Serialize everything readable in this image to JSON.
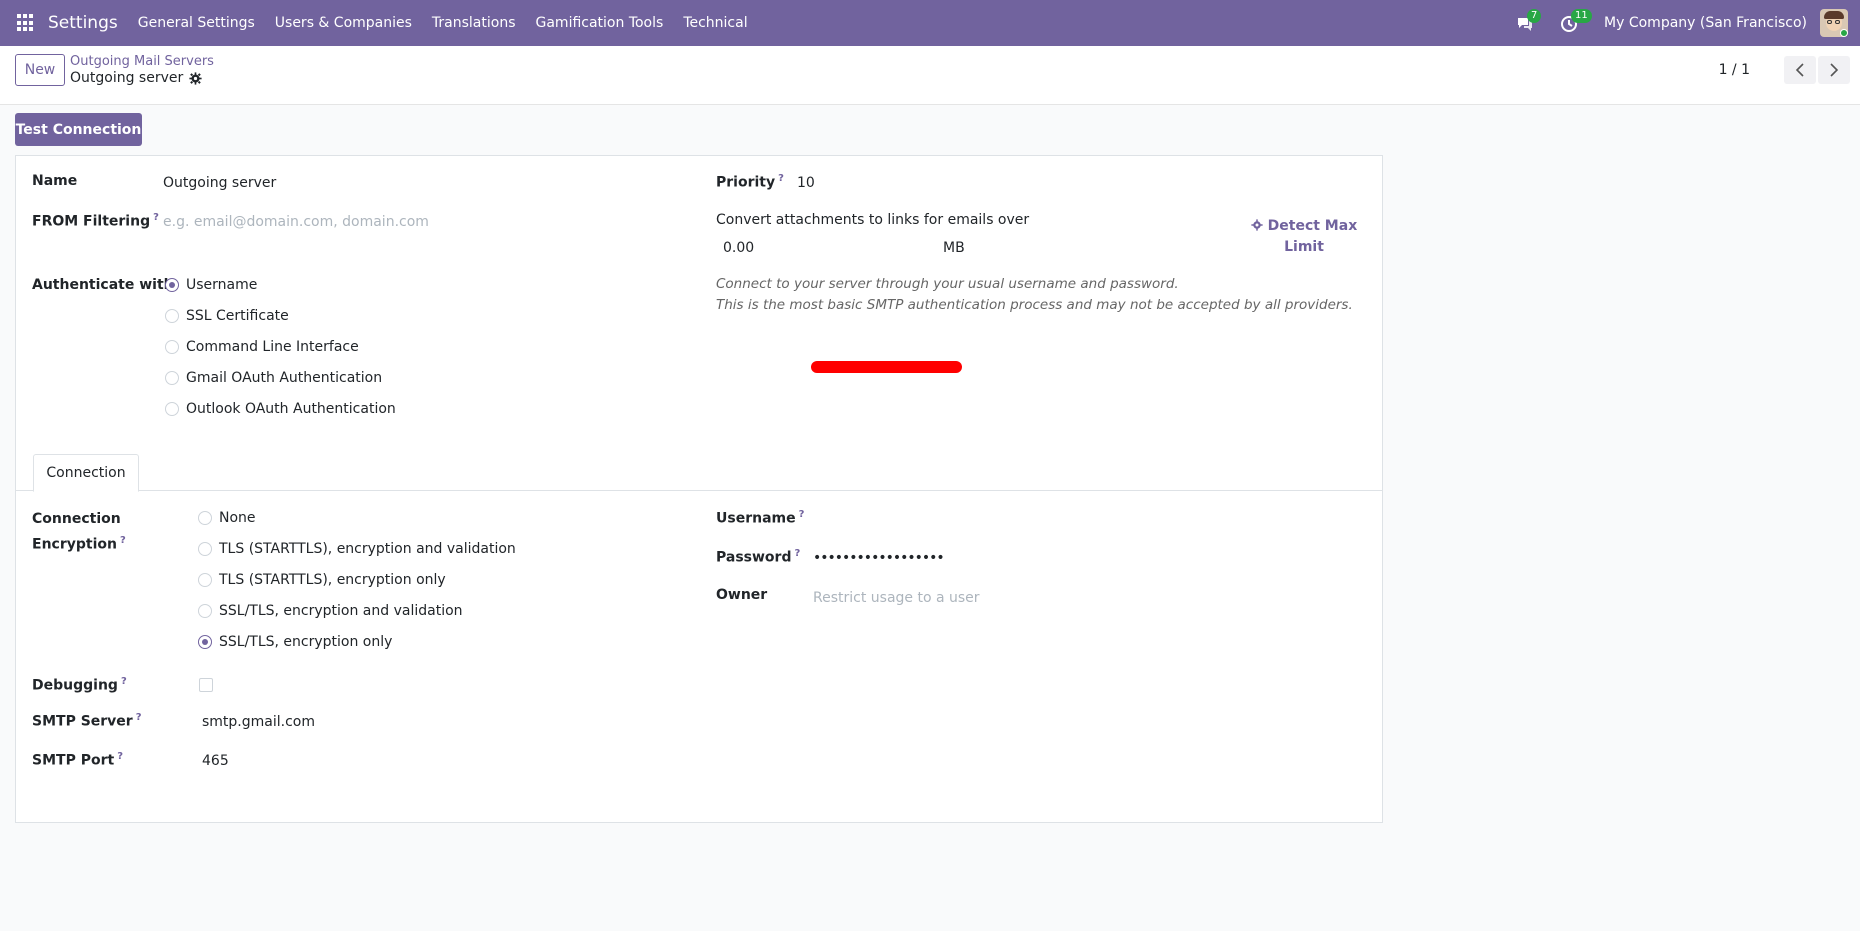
{
  "navbar": {
    "brand": "Settings",
    "menu": [
      "General Settings",
      "Users & Companies",
      "Translations",
      "Gamification Tools",
      "Technical"
    ],
    "messages_count": "7",
    "activities_count": "11",
    "company": "My Company (San Francisco)"
  },
  "control": {
    "new_label": "New",
    "breadcrumb_parent": "Outgoing Mail Servers",
    "breadcrumb_current": "Outgoing server",
    "pager": "1 / 1"
  },
  "actions": {
    "test_connection": "Test Connection"
  },
  "form": {
    "name_label": "Name",
    "name_value": "Outgoing server",
    "from_filter_label": "FROM Filtering",
    "from_filter_placeholder": "e.g. email@domain.com, domain.com",
    "priority_label": "Priority",
    "priority_value": "10",
    "convert_label": "Convert attachments to links for emails over",
    "convert_value": "0.00",
    "convert_unit": "MB",
    "detect_max_label": "Detect Max Limit",
    "authenticate_label": "Authenticate with",
    "auth_options": [
      "Username",
      "SSL Certificate",
      "Command Line Interface",
      "Gmail OAuth Authentication",
      "Outlook OAuth Authentication"
    ],
    "auth_selected": 0,
    "auth_hint_1": "Connect to your server through your usual username and password.",
    "auth_hint_2": "This is the most basic SMTP authentication process and may not be accepted by all providers."
  },
  "tabs": [
    "Connection"
  ],
  "connection": {
    "encryption_label_1": "Connection",
    "encryption_label_2": "Encryption",
    "encryption_options": [
      "None",
      "TLS (STARTTLS), encryption and validation",
      "TLS (STARTTLS), encryption only",
      "SSL/TLS, encryption and validation",
      "SSL/TLS, encryption only"
    ],
    "encryption_selected": 4,
    "debugging_label": "Debugging",
    "smtp_server_label": "SMTP Server",
    "smtp_server_value": "smtp.gmail.com",
    "smtp_port_label": "SMTP Port",
    "smtp_port_value": "465",
    "username_label": "Username",
    "password_label": "Password",
    "password_value": "••••••••••••••••••",
    "owner_label": "Owner",
    "owner_placeholder": "Restrict usage to a user"
  },
  "colors": {
    "brand": "#71639e",
    "badge": "#28a745",
    "redaction": "#ff0000"
  }
}
